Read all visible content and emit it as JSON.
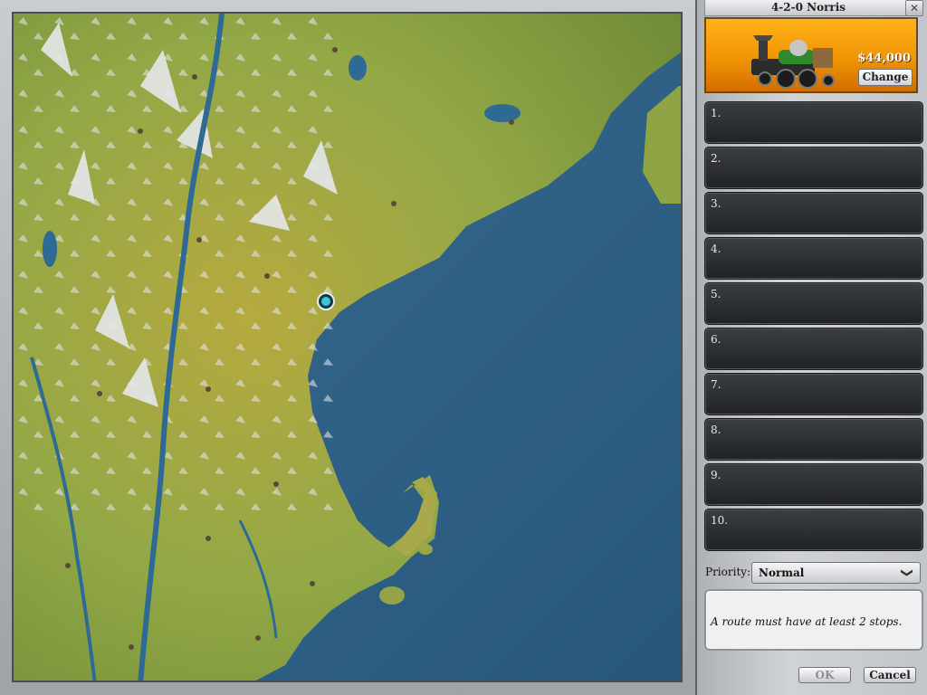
{
  "panel": {
    "title": "4-2-0 Norris",
    "engine": {
      "price": "$44,000",
      "change_label": "Change"
    },
    "stops": [
      "1.",
      "2.",
      "3.",
      "4.",
      "5.",
      "6.",
      "7.",
      "8.",
      "9.",
      "10."
    ],
    "priority": {
      "label": "Priority:",
      "value": "Normal"
    },
    "message": "A route must have at least 2 stops.",
    "buttons": {
      "ok": "OK",
      "cancel": "Cancel"
    }
  },
  "colors": {
    "water": "#2f5f85",
    "land_green": "#8aa43d",
    "land_yellow": "#b9a340",
    "mountain": "#d9dde0",
    "engine_bg": "#f39a0a"
  },
  "icons": {
    "close": "close-icon",
    "dropdown": "chevron-down-icon",
    "marker": "location-marker-icon"
  }
}
